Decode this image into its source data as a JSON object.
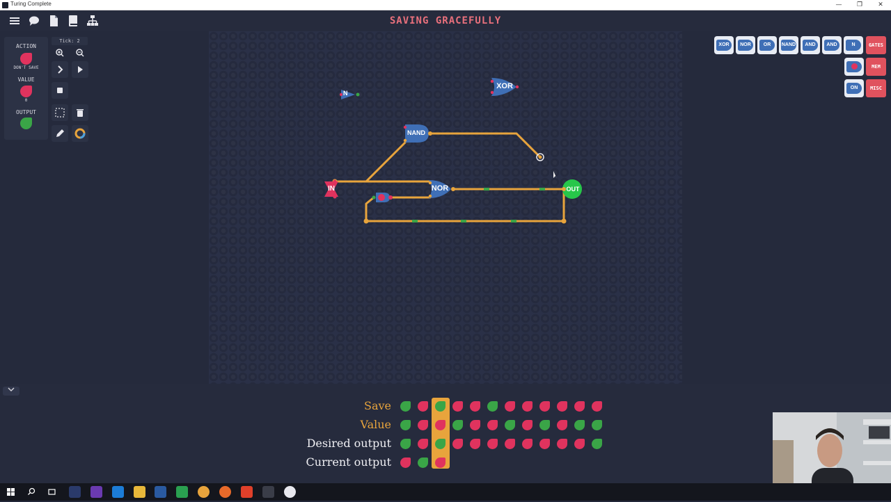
{
  "window": {
    "title": "Turing Complete",
    "minimize": "—",
    "maximize": "❐",
    "close": "✕"
  },
  "toolbar": {
    "level_title": "SAVING GRACEFULLY",
    "menu_icon": "menu-icon",
    "chat_icon": "chat-icon",
    "doc_icon": "document-icon",
    "book_icon": "book-icon",
    "hierarchy_icon": "hierarchy-icon"
  },
  "inputs_panel": {
    "action_label": "ACTION",
    "action_sub": "DON'T SAVE",
    "value_label": "VALUE",
    "value_sub": "0",
    "output_label": "OUTPUT"
  },
  "sim_controls": {
    "tick_label": "Tick: 2"
  },
  "canvas_components": {
    "not_gate": "N",
    "xor_gate": "XOR",
    "nand_gate": "NAND",
    "nor_gate": "NOR",
    "input_pin": "IN",
    "output_pin": "OUT"
  },
  "palette": {
    "gates": [
      "XOR",
      "NOR",
      "OR",
      "NAND",
      "AND",
      "AND",
      "N"
    ],
    "gates_label": "GATES",
    "mem_label": "MEM",
    "misc_label": "MISC",
    "misc_chip": "ON"
  },
  "truth_table": {
    "rows": [
      {
        "label": "Save",
        "color": "#e8a43c",
        "values": [
          "G",
          "R",
          "G",
          "R",
          "R",
          "G",
          "R",
          "R",
          "R",
          "R",
          "R",
          "R"
        ]
      },
      {
        "label": "Value",
        "color": "#e8a43c",
        "values": [
          "G",
          "R",
          "R",
          "G",
          "R",
          "R",
          "G",
          "R",
          "G",
          "R",
          "G",
          "G"
        ]
      },
      {
        "label": "Desired output",
        "color": "#f0f0f4",
        "values": [
          "G",
          "R",
          "G",
          "R",
          "R",
          "R",
          "R",
          "R",
          "R",
          "R",
          "R",
          "G"
        ]
      },
      {
        "label": "Current output",
        "color": "#f0f0f4",
        "values": [
          "R",
          "G",
          "R"
        ]
      }
    ],
    "current_index": 2,
    "colors": {
      "green": "#3aa547",
      "red": "#e0335e"
    }
  }
}
